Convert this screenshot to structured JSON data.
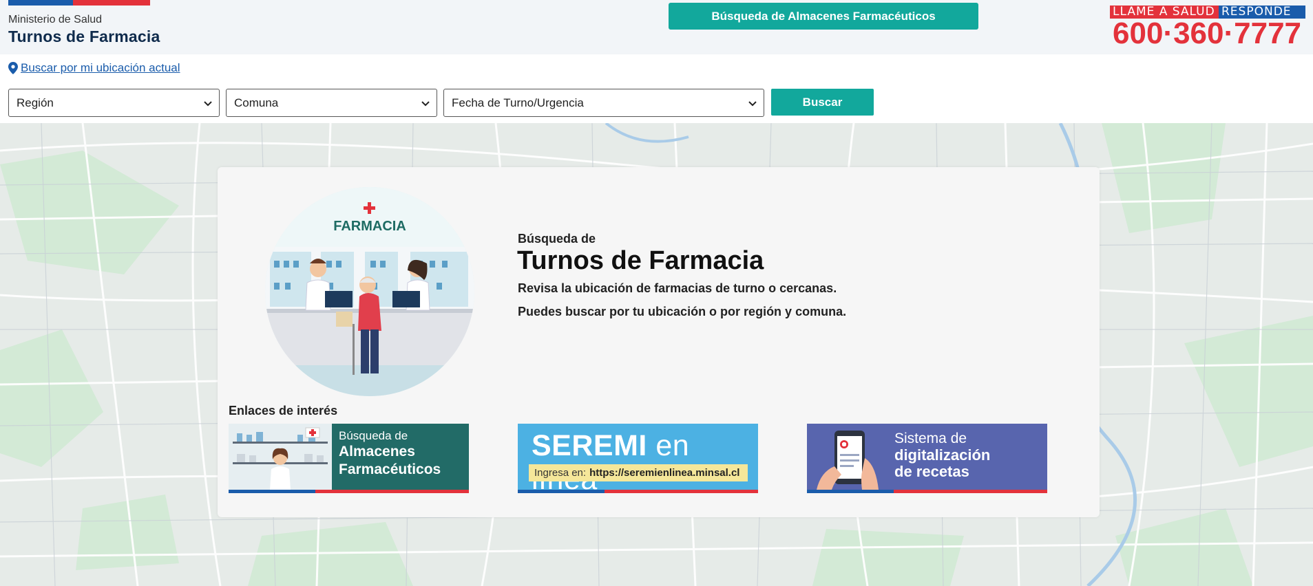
{
  "header": {
    "ministry": "Ministerio de Salud",
    "title": "Turnos de Farmacia",
    "cta_label": "Búsqueda de Almacenes Farmacéuticos",
    "salud_llame": "LLAME A SALUD",
    "salud_responde": "RESPONDE",
    "phone": "600·360·7777"
  },
  "search": {
    "location_link": "Buscar por mi ubicación actual",
    "region": "Región",
    "comuna": "Comuna",
    "fecha": "Fecha de Turno/Urgencia",
    "buscar": "Buscar"
  },
  "hero": {
    "pre_title": "Búsqueda de",
    "title": "Turnos de Farmacia",
    "line1": "Revisa la ubicación de farmacias de turno o cercanas.",
    "line2": "Puedes buscar por tu ubicación o por región y comuna.",
    "illustration_sign": "FARMACIA"
  },
  "links": {
    "heading": "Enlaces de interés",
    "almacenes": {
      "small": "Búsqueda de",
      "line1": "Almacenes",
      "line2": "Farmacéuticos"
    },
    "seremi": {
      "bold": "SEREMI",
      "light": "en línea",
      "ingresa": "Ingresa en:",
      "url": "https://seremienlinea.minsal.cl"
    },
    "recetas": {
      "small": "Sistema de",
      "line1": "digitalización",
      "line2": "de recetas"
    }
  },
  "colors": {
    "teal": "#12a89c",
    "gov_blue": "#1a5cab",
    "gov_red": "#e3323b",
    "navy": "#0f2b4c"
  },
  "icons": [
    "location-pin-icon",
    "chevron-down-icon"
  ]
}
